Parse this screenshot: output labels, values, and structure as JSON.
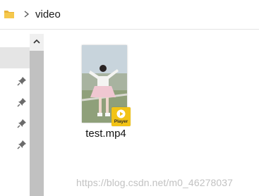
{
  "address_bar": {
    "folder_icon": "folder-icon",
    "separator_icon": "chevron-right-icon",
    "current_folder": "video"
  },
  "nav_pane": {
    "pin_icons": [
      "pin-icon",
      "pin-icon",
      "pin-icon",
      "pin-icon"
    ]
  },
  "scrollbar": {
    "up_icon": "chevron-up-icon"
  },
  "files": [
    {
      "name": "test.mp4",
      "thumbnail": "video-thumbnail",
      "badge_label": "Player",
      "badge_icon": "play-icon"
    }
  ],
  "watermark": "https://blog.csdn.net/m0_46278037",
  "colors": {
    "folder": "#e8b339",
    "badge": "#f2c316",
    "scroll_thumb": "#c1c1c1",
    "nav_selected": "#e5e5e5"
  }
}
